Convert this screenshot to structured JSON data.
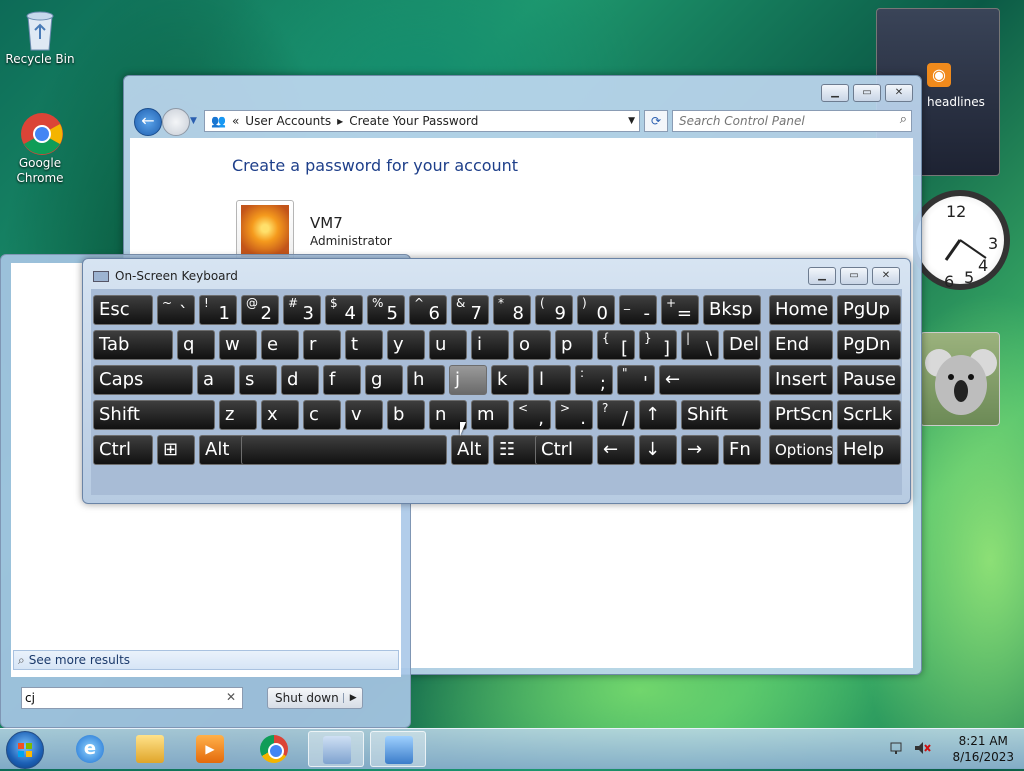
{
  "desktop": {
    "icons": [
      {
        "label": "Recycle Bin"
      },
      {
        "label": "Google Chrome"
      }
    ]
  },
  "gadgets": {
    "feed_label": "headlines",
    "clock_numbers": [
      "12",
      "3",
      "4",
      "5",
      "6"
    ]
  },
  "control_panel": {
    "breadcrumb": [
      "User Accounts",
      "Create Your Password"
    ],
    "search_placeholder": "Search Control Panel",
    "heading": "Create a password for your account",
    "user_name": "VM7",
    "user_role": "Administrator"
  },
  "start_menu": {
    "see_more": "See more results",
    "search_value": "cj",
    "shutdown_label": "Shut down"
  },
  "osk": {
    "title": "On-Screen Keyboard",
    "rows": [
      [
        {
          "k": "Esc"
        },
        {
          "s": "~",
          "l": "`"
        },
        {
          "s": "!",
          "l": "1"
        },
        {
          "s": "@",
          "l": "2"
        },
        {
          "s": "#",
          "l": "3"
        },
        {
          "s": "$",
          "l": "4"
        },
        {
          "s": "%",
          "l": "5"
        },
        {
          "s": "^",
          "l": "6"
        },
        {
          "s": "&",
          "l": "7"
        },
        {
          "s": "*",
          "l": "8"
        },
        {
          "s": "(",
          "l": "9"
        },
        {
          "s": ")",
          "l": "0"
        },
        {
          "s": "_",
          "l": "-"
        },
        {
          "s": "+",
          "l": "="
        },
        {
          "k": "Bksp"
        },
        {
          "k": "Home"
        },
        {
          "k": "PgUp"
        }
      ],
      [
        {
          "k": "Tab"
        },
        {
          "k": "q"
        },
        {
          "k": "w"
        },
        {
          "k": "e"
        },
        {
          "k": "r"
        },
        {
          "k": "t"
        },
        {
          "k": "y"
        },
        {
          "k": "u"
        },
        {
          "k": "i"
        },
        {
          "k": "o"
        },
        {
          "k": "p"
        },
        {
          "s": "{",
          "l": "["
        },
        {
          "s": "}",
          "l": "]"
        },
        {
          "s": "|",
          "l": "\\"
        },
        {
          "k": "Del"
        },
        {
          "k": "End"
        },
        {
          "k": "PgDn"
        }
      ],
      [
        {
          "k": "Caps"
        },
        {
          "k": "a"
        },
        {
          "k": "s"
        },
        {
          "k": "d"
        },
        {
          "k": "f"
        },
        {
          "k": "g"
        },
        {
          "k": "h"
        },
        {
          "k": "j"
        },
        {
          "k": "k"
        },
        {
          "k": "l"
        },
        {
          "s": ":",
          "l": ";"
        },
        {
          "s": "\"",
          "l": "'"
        },
        {
          "k": "←"
        },
        {
          "k": "Insert"
        },
        {
          "k": "Pause"
        }
      ],
      [
        {
          "k": "Shift"
        },
        {
          "k": "z"
        },
        {
          "k": "x"
        },
        {
          "k": "c"
        },
        {
          "k": "v"
        },
        {
          "k": "b"
        },
        {
          "k": "n"
        },
        {
          "k": "m"
        },
        {
          "s": "<",
          "l": ","
        },
        {
          "s": ">",
          "l": "."
        },
        {
          "s": "?",
          "l": "/"
        },
        {
          "k": "↑"
        },
        {
          "k": "Shift"
        },
        {
          "k": "PrtScn"
        },
        {
          "k": "ScrLk"
        }
      ],
      [
        {
          "k": "Ctrl"
        },
        {
          "k": "⊞"
        },
        {
          "k": "Alt"
        },
        {
          "k": ""
        },
        {
          "k": "Alt"
        },
        {
          "k": "☷"
        },
        {
          "k": "Ctrl"
        },
        {
          "k": "←"
        },
        {
          "k": "↓"
        },
        {
          "k": "→"
        },
        {
          "k": "Fn"
        },
        {
          "k": "Options"
        },
        {
          "k": "Help"
        }
      ]
    ]
  },
  "taskbar": {
    "time": "8:21 AM",
    "date": "8/16/2023"
  },
  "colors": {
    "accent_link": "#1e3f8a",
    "key_bg": "#1a1a1a",
    "key_highlight": "#8a8a8a"
  }
}
